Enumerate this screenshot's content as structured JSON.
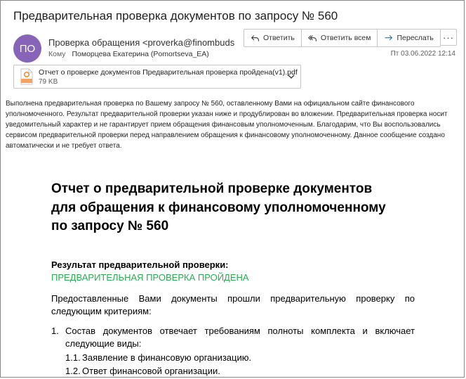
{
  "email": {
    "subject": "Предварительная проверка документов по запросу № 560",
    "avatar_initials": "ПО",
    "avatar_color": "#8764b8",
    "sender": "Проверка обращения <proverka@finombudsm",
    "to_label": "Кому",
    "to_name": "Поморцева Екатерина (Pomortseva_EA)",
    "date": "Пт 03.06.2022 12:14"
  },
  "actions": {
    "reply": "Ответить",
    "reply_all": "Ответить всем",
    "forward": "Переслать",
    "more": "···"
  },
  "attachment": {
    "name": "Отчет о проверке документов Предварительная проверка пройдена(v1).pdf",
    "size": "79 KB",
    "icon": "pdf-file-icon"
  },
  "body": {
    "intro": "Выполнена предварительная проверка по Вашему запросу № 560, оставленному Вами на официальном сайте финансового уполномоченного. Результат предварительной проверки указан ниже и продублирован во вложении. Предварительная проверка носит уведомительный характер и не гарантирует прием обращения финансовым уполномоченным. Благодарим, что Вы воспользовались сервисом предварительной проверки перед направлением обращения к финансовому уполномоченному. Данное сообщение создано автоматически и не требует ответа."
  },
  "document": {
    "title": "Отчет о предварительной  проверке документов\nдля обращения к финансовому уполномоченному\nпо запросу № 560",
    "result_label": "Результат предварительной проверки:",
    "result_value": "ПРЕДВАРИТЕЛЬНАЯ ПРОВЕРКА ПРОЙДЕНА",
    "result_color": "#2eaa55",
    "paragraph": "Предоставленные Вами документы прошли предварительную проверку по следующим критериям:",
    "list": [
      {
        "number": "1.",
        "text": "Состав документов отвечает требованиям полноты комплекта и включает следующие виды:",
        "subitems": [
          {
            "number": "1.1.",
            "text": "Заявление в финансовую организацию."
          },
          {
            "number": "1.2.",
            "text": "Ответ финансовой организации."
          }
        ]
      }
    ]
  }
}
